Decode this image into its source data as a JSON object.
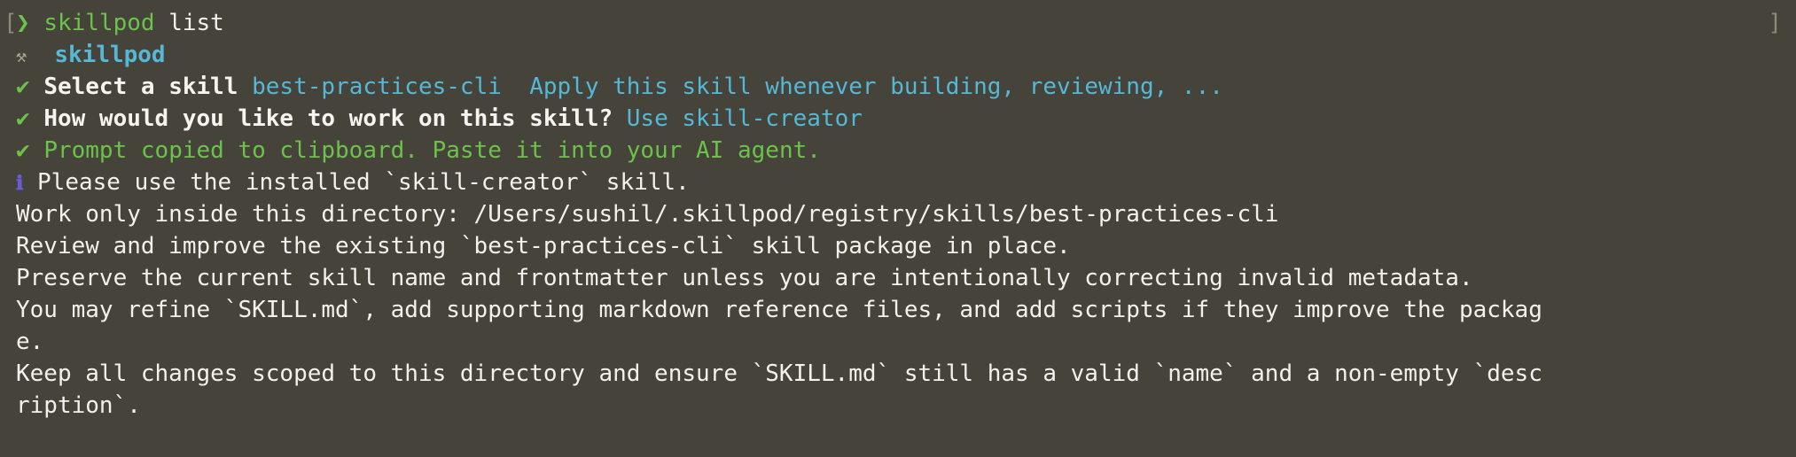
{
  "window": {
    "left_bracket": "[",
    "right_bracket": "]"
  },
  "prompt": {
    "arrow": "❯",
    "command": "skillpod",
    "args": " list"
  },
  "header": {
    "icon": "⚒",
    "icon_name": "hammer-icon",
    "title": "skillpod"
  },
  "steps": [
    {
      "check": "✔",
      "question": "Select a skill",
      "answer": "best-practices-cli",
      "hint": "Apply this skill whenever building, reviewing, ..."
    },
    {
      "check": "✔",
      "question": "How would you like to work on this skill?",
      "answer": "Use skill-creator"
    },
    {
      "check": "✔",
      "message": "Prompt copied to clipboard. Paste it into your AI agent."
    }
  ],
  "info": {
    "icon": "ℹ",
    "icon_name": "info-icon",
    "message": "Please use the installed `skill-creator` skill."
  },
  "output_lines": [
    "Work only inside this directory: /Users/sushil/.skillpod/registry/skills/best-practices-cli",
    "Review and improve the existing `best-practices-cli` skill package in place.",
    "Preserve the current skill name and frontmatter unless you are intentionally correcting invalid metadata.",
    "You may refine `SKILL.md`, add supporting markdown reference files, and add scripts if they improve the packag",
    "e.",
    "Keep all changes scoped to this directory and ensure `SKILL.md` still has a valid `name` and a non-empty `desc",
    "ription`."
  ],
  "colors": {
    "background": "#45433a",
    "green": "#6cc24a",
    "cyan": "#55b8d6",
    "purple": "#6b5bd6",
    "text": "#f2f1ec"
  }
}
